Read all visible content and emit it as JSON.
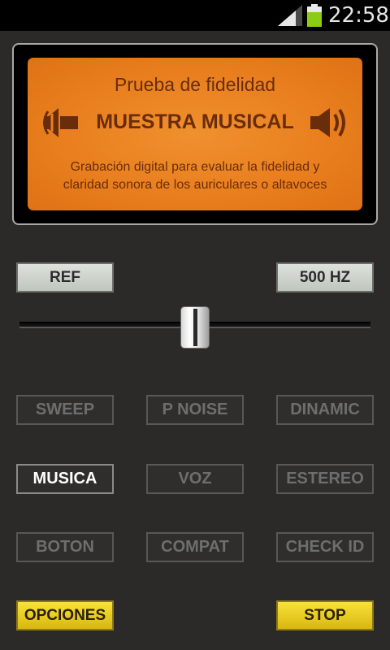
{
  "status_bar": {
    "time": "22:58",
    "icons": [
      "signal-icon",
      "battery-icon"
    ],
    "battery_color": "#8ccc14"
  },
  "panel": {
    "title": "Prueba de fidelidad",
    "heading": "MUESTRA MUSICAL",
    "description_line1": "Grabación digital para evaluar la fidelidad y",
    "description_line2": "claridad sonora de los auriculares o altavoces",
    "left_icon": "speaker-left-icon",
    "right_icon": "speaker-right-icon",
    "color": "#e97f1f",
    "text_color": "#6a2d0c"
  },
  "controls": {
    "ref_label": "REF",
    "freq_label": "500 HZ",
    "slider_value": 0.5
  },
  "buttons": {
    "sweep": "SWEEP",
    "p_noise": "P NOISE",
    "dinamic": "DINAMIC",
    "musica": "MUSICA",
    "voz": "VOZ",
    "estereo": "ESTEREO",
    "boton": "BOTON",
    "compat": "COMPAT",
    "check_id": "CHECK ID",
    "opciones": "OPCIONES",
    "stop": "STOP"
  },
  "colors": {
    "background": "#2b2a29",
    "accent_yellow": "#f0d42a"
  }
}
